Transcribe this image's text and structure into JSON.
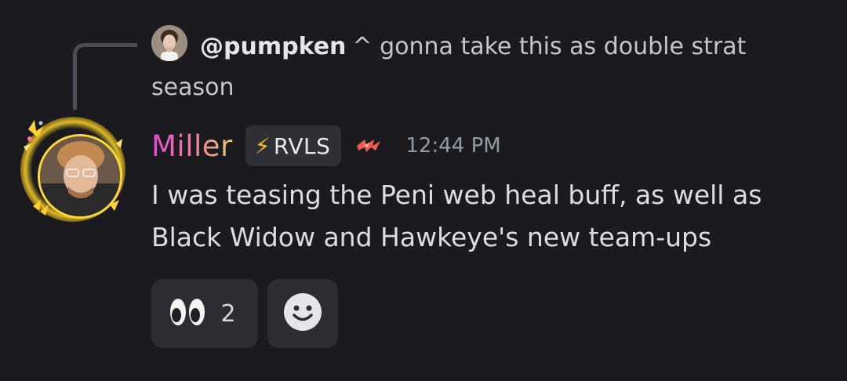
{
  "reply": {
    "username": "@pumpken",
    "caret": "^",
    "text": "gonna take this as double strat season"
  },
  "message": {
    "author": "Miller",
    "tag": "RVLS",
    "tag_icon": "lightning-icon",
    "role_icon": "rivals-logo-icon",
    "timestamp": "12:44 PM",
    "text": "I was teasing the Peni web heal buff, as well as Black Widow and Hawkeye's new team-ups"
  },
  "reactions": [
    {
      "emoji": "eyes-emoji",
      "count": "2"
    }
  ],
  "add_reaction": {
    "icon": "smiley-icon"
  },
  "colors": {
    "background": "#1b1b1f",
    "chip": "#2e3036",
    "reaction_bg": "#2b2d33",
    "timestamp": "#949ba4",
    "username_gradient_start": "#e04ad6",
    "username_gradient_end": "#e7c36a"
  }
}
